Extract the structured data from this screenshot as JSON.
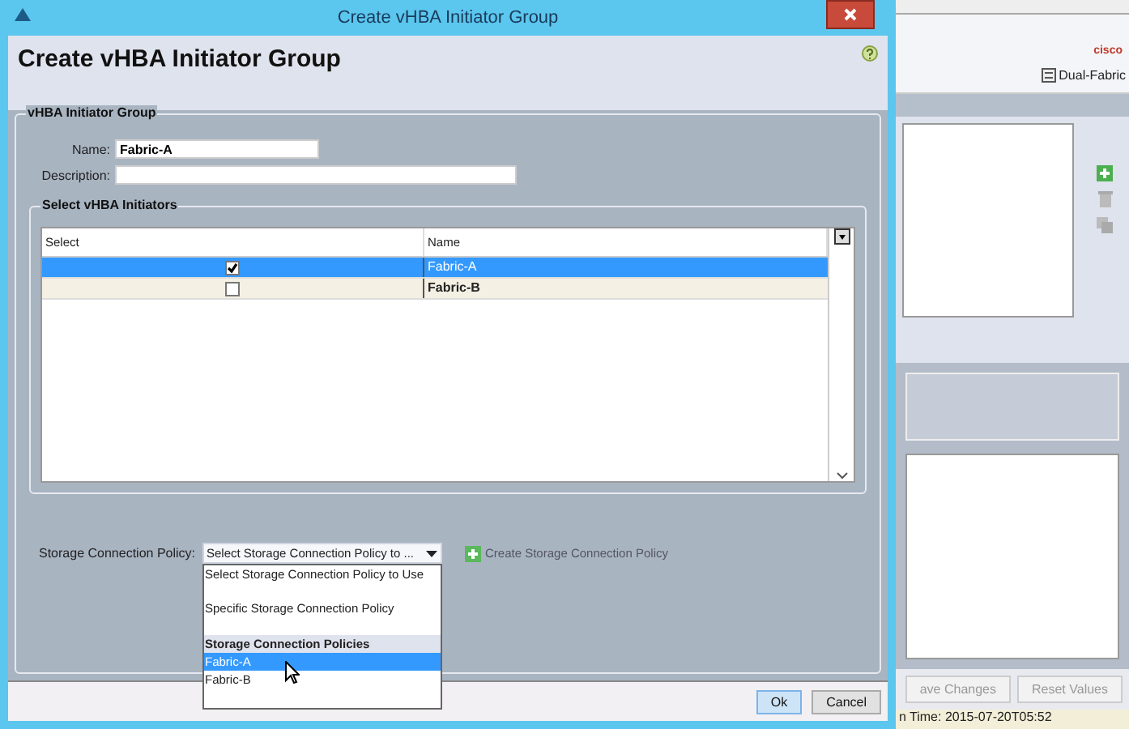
{
  "background_window": {
    "logo_text": "cisco",
    "toolbar_button": "Dual-Fabric",
    "buttons": [
      "ave Changes",
      "Reset Values"
    ],
    "status_text": "n Time: 2015-07-20T05:52"
  },
  "dialog": {
    "title": "Create vHBA Initiator Group",
    "heading": "Create vHBA Initiator Group",
    "group": {
      "title": "vHBA Initiator Group",
      "name": {
        "label": "Name:",
        "value": "Fabric-A"
      },
      "description": {
        "label": "Description:"
      },
      "initiators": {
        "title": "Select vHBA Initiators",
        "columns": [
          "Select",
          "Name"
        ],
        "rows": [
          {
            "name": "Fabric-A",
            "checked": true,
            "selected": true
          },
          {
            "name": "Fabric-B",
            "checked": false,
            "selected": false
          }
        ]
      },
      "policy": {
        "label": "Storage Connection Policy:",
        "value": "Select Storage Connection Policy to ...",
        "expanded": true,
        "options": [
          {
            "kind": "choice",
            "label": "Select Storage Connection Policy to Use",
            "selected": false
          },
          {
            "kind": "choice",
            "label": "Specific Storage Connection Policy",
            "selected": false
          },
          {
            "kind": "header",
            "label": "Storage Connection Policies",
            "selected": false
          },
          {
            "kind": "policy",
            "label": "Fabric-A",
            "selected": true
          },
          {
            "kind": "policy",
            "label": "Fabric-B",
            "selected": false
          }
        ]
      },
      "create_link": "Create Storage Connection Policy"
    },
    "buttons": [
      {
        "label": "Ok",
        "kind": "primary"
      },
      {
        "label": "Cancel",
        "kind": "secondary"
      }
    ]
  }
}
